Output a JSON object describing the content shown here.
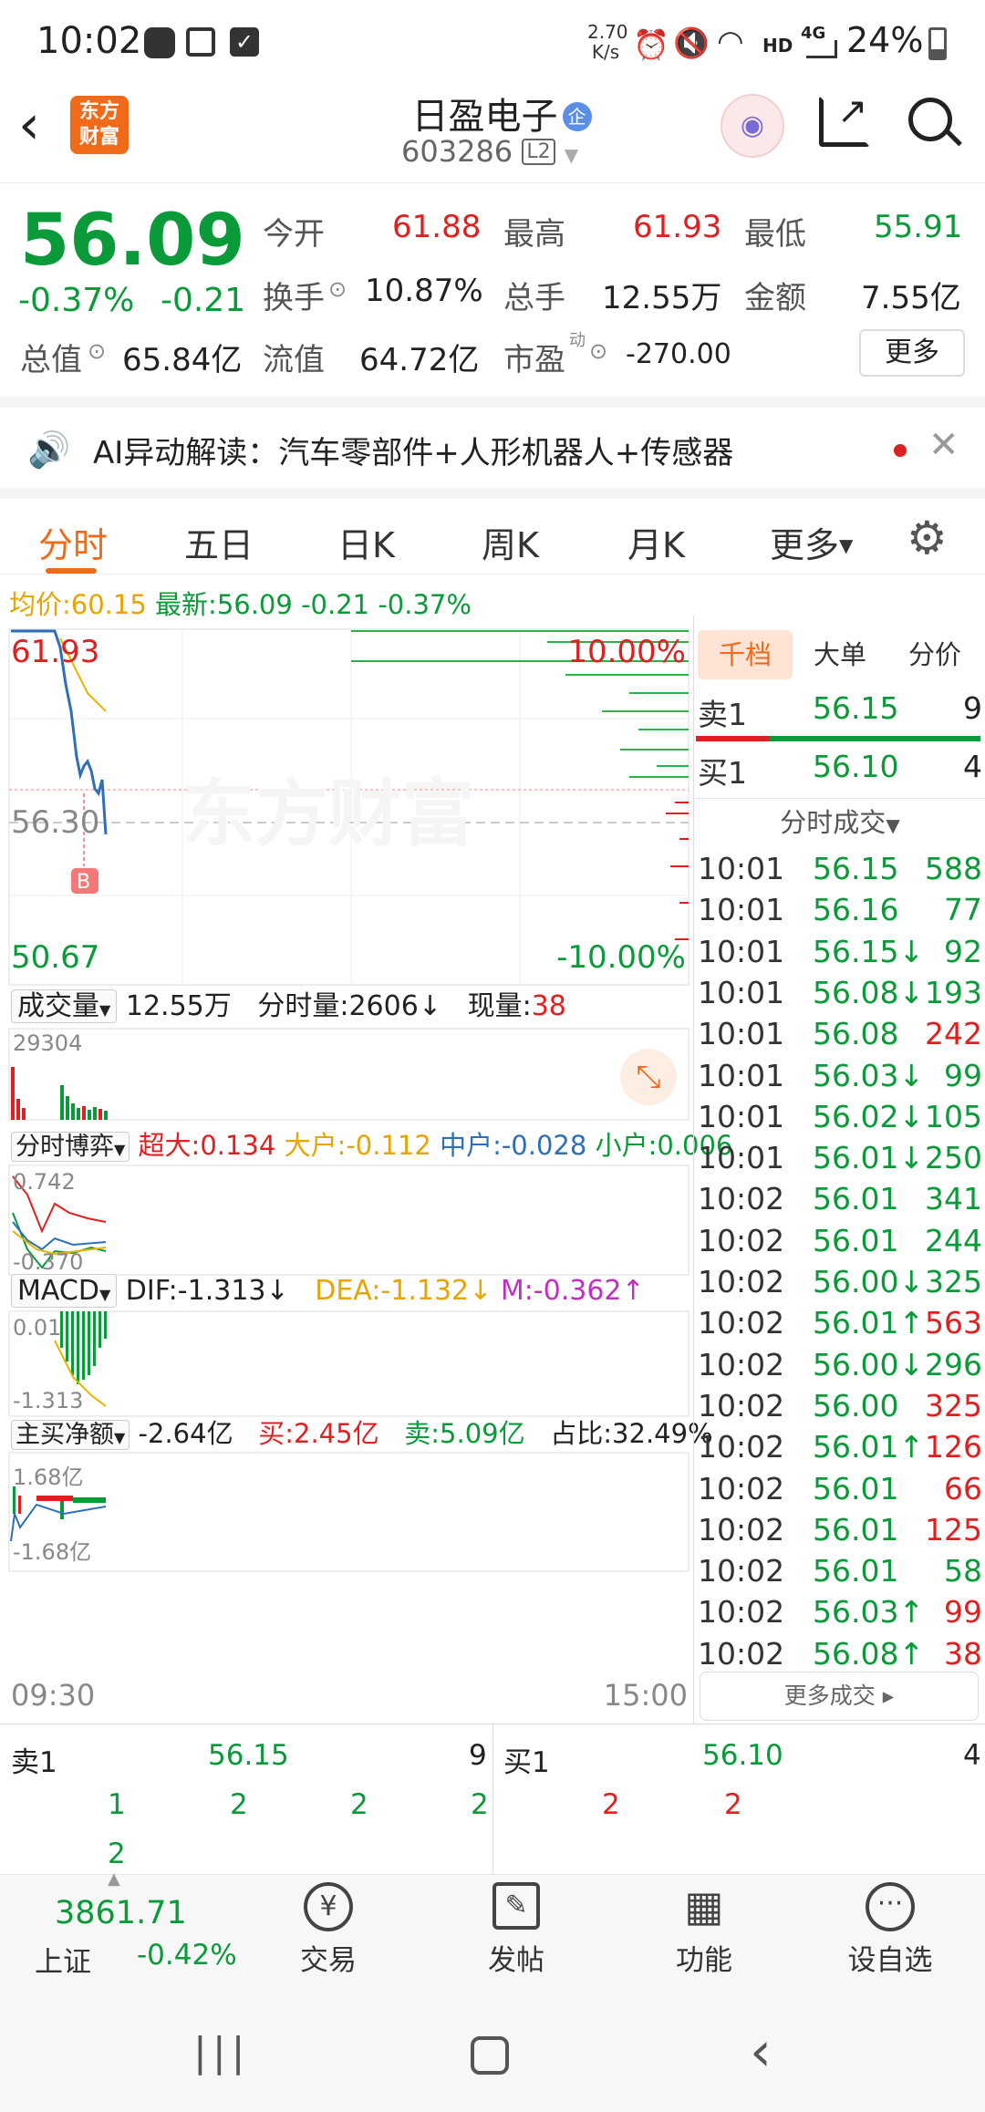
{
  "status": {
    "time": "10:02",
    "speed_top": "2.70",
    "speed_bottom": "K/s",
    "network": "4G",
    "battery": "24%",
    "hd": "HD"
  },
  "header": {
    "title": "日盈电子",
    "badge": "企",
    "code": "603286",
    "level": "L2",
    "logo_line1": "东方",
    "logo_line2": "财富"
  },
  "quote": {
    "price": "56.09",
    "pct": "-0.37%",
    "chg": "-0.21",
    "open_label": "今开",
    "open": "61.88",
    "high_label": "最高",
    "high": "61.93",
    "low_label": "最低",
    "low": "55.91",
    "turnover_label": "换手",
    "turnover": "10.87%",
    "volume_label": "总手",
    "volume": "12.55万",
    "amount_label": "金额",
    "amount": "7.55亿",
    "mktcap_label": "总值",
    "mktcap": "65.84亿",
    "float_label": "流值",
    "float": "64.72亿",
    "pe_label": "市盈",
    "pe_sup": "动",
    "pe": "-270.00",
    "more": "更多"
  },
  "ai": {
    "text": "AI异动解读：汽车零部件+人形机器人+传感器"
  },
  "tabs": [
    "分时",
    "五日",
    "日K",
    "周K",
    "月K",
    "更多"
  ],
  "chart": {
    "avg_label": "均价:",
    "avg": "60.15",
    "latest_label": "最新:",
    "latest": "56.09",
    "chg": "-0.21",
    "pct": "-0.37%",
    "high": "61.93",
    "mid": "56.30",
    "low": "50.67",
    "up_pct": "10.00%",
    "down_pct": "-10.00%",
    "b_marker": "B",
    "watermark": "东方财富",
    "vol_label": "成交量",
    "vol_total": "12.55万",
    "vol_min_label": "分时量:2606",
    "vol_now_label": "现量:",
    "vol_now": "38",
    "vol_max": "29304",
    "game_label": "分时博弈",
    "super_label": "超大:",
    "super": "0.134",
    "big_label": "大户:",
    "big": "-0.112",
    "mid_label": "中户:",
    "mid_v": "-0.028",
    "small_label": "小户:",
    "small": "0.006",
    "game_top": "0.742",
    "game_bottom": "-0.370",
    "macd_label": "MACD",
    "dif": "DIF:-1.313",
    "dea": "DEA:-1.132",
    "m": "M:-0.362",
    "macd_top": "0.01",
    "macd_bottom": "-1.313",
    "net_label": "主买净额",
    "net": "-2.64亿",
    "buy_label": "买:",
    "buy": "2.45亿",
    "sell_label": "卖:",
    "sell": "5.09亿",
    "ratio": "占比:32.49%",
    "net_top": "1.68亿",
    "net_bottom": "-1.68亿",
    "time_start": "09:30",
    "time_end": "15:00"
  },
  "trades": {
    "tabs": [
      "千档",
      "大单",
      "分价"
    ],
    "sell1_label": "卖1",
    "sell1_price": "56.15",
    "sell1_vol": "9",
    "buy1_label": "买1",
    "buy1_price": "56.10",
    "buy1_vol": "4",
    "list_title": "分时成交",
    "rows": [
      {
        "t": "10:01",
        "p": "56.15",
        "v": "588",
        "pc": "green",
        "vc": "green"
      },
      {
        "t": "10:01",
        "p": "56.16",
        "v": "77",
        "pc": "green",
        "vc": "green"
      },
      {
        "t": "10:01",
        "p": "56.15↓",
        "v": "92",
        "pc": "green",
        "vc": "green"
      },
      {
        "t": "10:01",
        "p": "56.08↓",
        "v": "193",
        "pc": "green",
        "vc": "green"
      },
      {
        "t": "10:01",
        "p": "56.08",
        "v": "242",
        "pc": "green",
        "vc": "red"
      },
      {
        "t": "10:01",
        "p": "56.03↓",
        "v": "99",
        "pc": "green",
        "vc": "green"
      },
      {
        "t": "10:01",
        "p": "56.02↓",
        "v": "105",
        "pc": "green",
        "vc": "green"
      },
      {
        "t": "10:01",
        "p": "56.01↓",
        "v": "250",
        "pc": "green",
        "vc": "green"
      },
      {
        "t": "10:02",
        "p": "56.01",
        "v": "341",
        "pc": "green",
        "vc": "green"
      },
      {
        "t": "10:02",
        "p": "56.01",
        "v": "244",
        "pc": "green",
        "vc": "green"
      },
      {
        "t": "10:02",
        "p": "56.00↓",
        "v": "325",
        "pc": "green",
        "vc": "green"
      },
      {
        "t": "10:02",
        "p": "56.01↑",
        "v": "563",
        "pc": "green",
        "vc": "red"
      },
      {
        "t": "10:02",
        "p": "56.00↓",
        "v": "296",
        "pc": "green",
        "vc": "green"
      },
      {
        "t": "10:02",
        "p": "56.00",
        "v": "325",
        "pc": "green",
        "vc": "red"
      },
      {
        "t": "10:02",
        "p": "56.01↑",
        "v": "126",
        "pc": "green",
        "vc": "red"
      },
      {
        "t": "10:02",
        "p": "56.01",
        "v": "66",
        "pc": "green",
        "vc": "red"
      },
      {
        "t": "10:02",
        "p": "56.01",
        "v": "125",
        "pc": "green",
        "vc": "red"
      },
      {
        "t": "10:02",
        "p": "56.01",
        "v": "58",
        "pc": "green",
        "vc": "green"
      },
      {
        "t": "10:02",
        "p": "56.03↑",
        "v": "99",
        "pc": "green",
        "vc": "red"
      },
      {
        "t": "10:02",
        "p": "56.08↑",
        "v": "38",
        "pc": "green",
        "vc": "red"
      }
    ],
    "more": "更多成交"
  },
  "bottom": {
    "sell1_label": "卖1",
    "sell1_price": "56.15",
    "sell1_vol": "9",
    "buy1_label": "买1",
    "buy1_price": "56.10",
    "buy1_vol": "4",
    "sell_queue": [
      "1",
      "2",
      "2",
      "2",
      "2"
    ],
    "buy_queue": [
      "2",
      "2"
    ]
  },
  "nav": {
    "index_value": "3861.71",
    "index_name": "上证",
    "index_pct": "-0.42%",
    "trade": "交易",
    "post": "发帖",
    "func": "功能",
    "watch": "设自选"
  },
  "colors": {
    "up": "#e02020",
    "down": "#0a9a3a",
    "accent": "#f06a1a",
    "avg": "#e8b400"
  }
}
